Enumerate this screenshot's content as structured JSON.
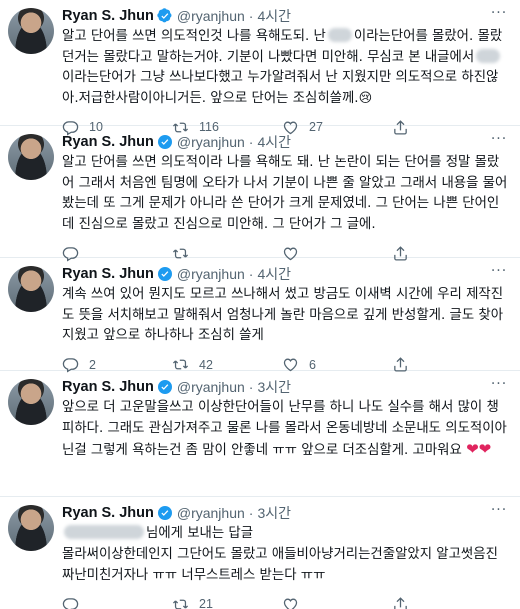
{
  "author": {
    "name": "Ryan S. Jhun",
    "handle": "@ryanjhun"
  },
  "colors": {
    "verified": "#1d9bf0",
    "heart": "#e0245e",
    "muted": "#536471"
  },
  "tweets": [
    {
      "time": "4시간",
      "text_a": "알고 단어를 쓰면 의도적인것 나를 욕해도되. 난",
      "text_b": "이라는단어를 몰랐어. 몰랐던거는 몰랐다고 말하는거야. 기분이 나빴다면 미안해. 무심코 본 내글에서",
      "text_c": "이라는단어가 그냥 쓰나보다했고 누가알려줘서 난 지웠지만 의도적으로 하진않아.저급한사람이아니거든. 앞으로 단어는 조심히쓸께.",
      "emoji": "😢",
      "replies": "10",
      "retweets": "116",
      "likes": "27"
    },
    {
      "time": "4시간",
      "text": "알고 단어를 쓰면 의도적이라 나를 욕해도 돼. 난 논란이 되는 단어를 정말 몰랐어 그래서 처음엔 팀명에 오타가 나서 기분이 나쁜 줄 알았고 그래서 내용을 물어봤는데 또 그게 문제가 아니라 쓴 단어가 크게 문제였네. 그 단어는 나쁜 단어인데 진심으로 몰랐고 진심으로 미안해. 그 단어가 그 글에.",
      "replies": "",
      "retweets": "",
      "likes": ""
    },
    {
      "time": "4시간",
      "text": "계속 쓰여 있어 뭔지도 모르고 쓰나해서 썼고 방금도 이새벽 시간에 우리 제작진도 뜻을 서치해보고 말해줘서 엄청나게 놀란 마음으로 깊게 반성할게. 글도 찾아 지웠고 앞으로 하나하나 조심히 쓸게",
      "replies": "2",
      "retweets": "42",
      "likes": "6"
    },
    {
      "time": "3시간",
      "text": "앞으로 더 고운말을쓰고 이상한단어들이 난무를 하니 나도 실수를 해서 많이 챙피하다. 그래도 관심가져주고 물론 나를 몰라서 온동네방네 소문내도 의도적이아닌걸 그렇게 욕하는건 좀 맘이 안좋네 ㅠㅠ 앞으로 더조심할게. 고마워요",
      "hearts": "❤❤",
      "replies": "",
      "retweets": "",
      "likes": ""
    },
    {
      "time": "3시간",
      "reply_suffix": "님에게 보내는 답글",
      "text": "몰라써이상한데인지 그단어도 몰랐고 애들비아냥거리는건줄알았지 알고썻음진짜난미친거자나 ㅠㅠ 너무스트레스 받는다 ㅠㅠ",
      "replies": "",
      "retweets": "21",
      "likes": ""
    }
  ]
}
